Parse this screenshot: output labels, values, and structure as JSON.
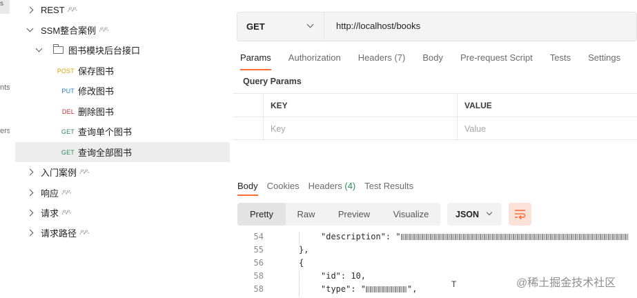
{
  "rail": {
    "fragments": [
      "nts",
      "ers"
    ]
  },
  "sidebar": {
    "items": [
      {
        "label": "REST",
        "type": "collection",
        "expanded": false
      },
      {
        "label": "SSM整合案例",
        "type": "collection",
        "expanded": true
      },
      {
        "label": "图书模块后台接口",
        "type": "folder",
        "expanded": true
      },
      {
        "label": "保存图书",
        "type": "request",
        "method": "POST"
      },
      {
        "label": "修改图书",
        "type": "request",
        "method": "PUT"
      },
      {
        "label": "删除图书",
        "type": "request",
        "method": "DEL"
      },
      {
        "label": "查询单个图书",
        "type": "request",
        "method": "GET"
      },
      {
        "label": "查询全部图书",
        "type": "request",
        "method": "GET",
        "selected": true
      },
      {
        "label": "入门案例",
        "type": "collection",
        "expanded": false
      },
      {
        "label": "响应",
        "type": "collection",
        "expanded": false
      },
      {
        "label": "请求",
        "type": "collection",
        "expanded": false
      },
      {
        "label": "请求路径",
        "type": "collection",
        "expanded": false
      }
    ]
  },
  "request": {
    "method": "GET",
    "url": "http://localhost/books",
    "tabs": [
      {
        "label": "Params",
        "active": true
      },
      {
        "label": "Authorization"
      },
      {
        "label": "Headers",
        "count": "(7)"
      },
      {
        "label": "Body"
      },
      {
        "label": "Pre-request Script"
      },
      {
        "label": "Tests"
      },
      {
        "label": "Settings"
      }
    ],
    "query_params_title": "Query Params",
    "table": {
      "key_header": "KEY",
      "value_header": "VALUE",
      "key_placeholder": "Key",
      "value_placeholder": "Value"
    }
  },
  "response": {
    "tabs": [
      {
        "label": "Body",
        "active": true
      },
      {
        "label": "Cookies"
      },
      {
        "label": "Headers",
        "count": "(4)"
      },
      {
        "label": "Test Results"
      }
    ],
    "formats": [
      "Pretty",
      "Raw",
      "Preview",
      "Visualize"
    ],
    "active_format": "Pretty",
    "language": "JSON",
    "code": [
      {
        "line": "54",
        "text": "\"description\": \"",
        "blurred": true
      },
      {
        "line": "55",
        "text": "},"
      },
      {
        "line": "56",
        "text": "{"
      },
      {
        "line": "58",
        "text": "\"id\": 10,"
      },
      {
        "line": "58",
        "text": "\"type\": \"",
        "blurred_tail": true
      }
    ]
  },
  "watermark": "@稀土掘金技术社区",
  "colors": {
    "accent": "#ff6c37",
    "post": "#d9a400",
    "put": "#2e7bc5",
    "del": "#c4342b",
    "get": "#2c8a5a"
  }
}
